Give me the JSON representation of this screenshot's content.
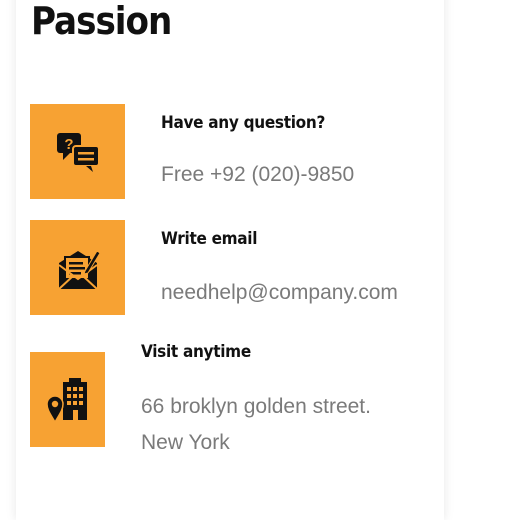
{
  "page_title": "Passion",
  "contacts": [
    {
      "icon": "question-chat-icon",
      "heading": "Have any question?",
      "value": "Free +92 (020)-9850"
    },
    {
      "icon": "email-letter-icon",
      "heading": "Write email",
      "value": "needhelp@company.com"
    },
    {
      "icon": "building-location-icon",
      "heading": "Visit anytime",
      "value_line1": "66 broklyn golden street.",
      "value_line2": "New York"
    }
  ],
  "colors": {
    "accent": "#f7a233",
    "heading": "#111111",
    "muted_text": "#7a7a7a"
  }
}
